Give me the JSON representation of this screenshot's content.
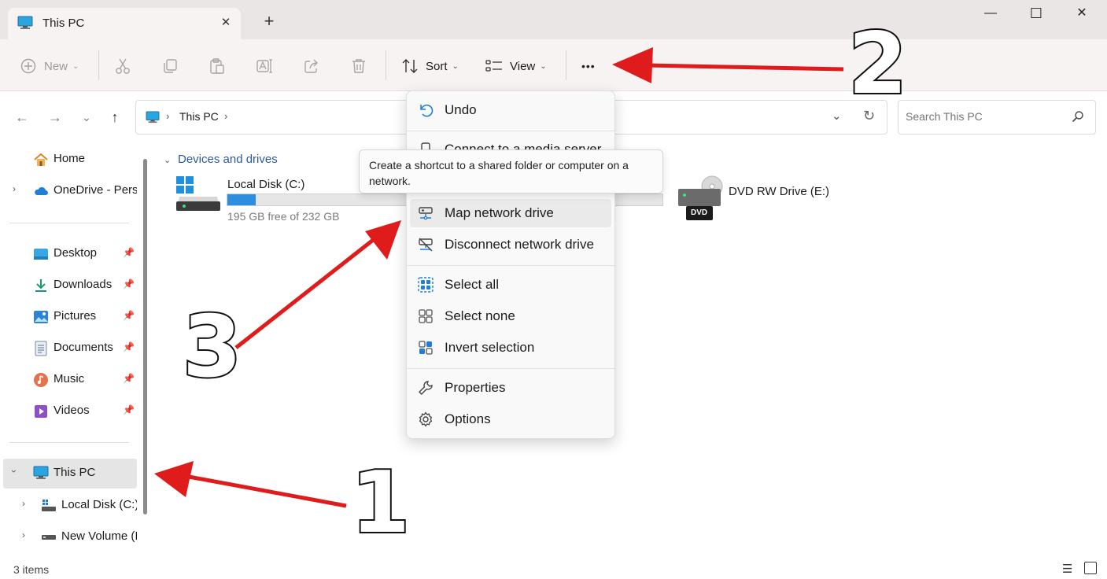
{
  "window": {
    "tab_title": "This PC",
    "new_tab_symbol": "+",
    "minimize_symbol": "—",
    "maximize_symbol": "☐",
    "close_symbol": "✕"
  },
  "toolbar": {
    "new_label": "New",
    "sort_label": "Sort",
    "view_label": "View",
    "more_label": "•••"
  },
  "address": {
    "path_item": "This PC",
    "search_placeholder": "Search This PC"
  },
  "sidebar": {
    "home": "Home",
    "onedrive": "OneDrive - Perso",
    "quick": [
      {
        "label": "Desktop",
        "icon": "desktop-folder-icon"
      },
      {
        "label": "Downloads",
        "icon": "downloads-icon"
      },
      {
        "label": "Pictures",
        "icon": "pictures-icon"
      },
      {
        "label": "Documents",
        "icon": "documents-icon"
      },
      {
        "label": "Music",
        "icon": "music-icon"
      },
      {
        "label": "Videos",
        "icon": "videos-icon"
      }
    ],
    "this_pc": "This PC",
    "local_disk": "Local Disk (C:)",
    "new_volume": "New Volume (I"
  },
  "content": {
    "group_header": "Devices and drives",
    "drives": [
      {
        "name": "Local Disk (C:)",
        "free_text": "195 GB free of 232 GB",
        "used_fraction": 0.16
      },
      {
        "name": "DVD RW Drive (E:)",
        "badge": "DVD"
      }
    ]
  },
  "menu": {
    "items": [
      {
        "label": "Undo",
        "icon": "undo-icon"
      },
      {
        "label": "Connect to a media server",
        "icon": "media-server-icon"
      },
      {
        "label": "Map network drive",
        "icon": "map-network-drive-icon"
      },
      {
        "label": "Disconnect network drive",
        "icon": "disconnect-network-drive-icon"
      },
      {
        "label": "Select all",
        "icon": "select-all-icon"
      },
      {
        "label": "Select none",
        "icon": "select-none-icon"
      },
      {
        "label": "Invert selection",
        "icon": "invert-selection-icon"
      },
      {
        "label": "Properties",
        "icon": "properties-icon"
      },
      {
        "label": "Options",
        "icon": "options-icon"
      }
    ],
    "tooltip": "Create a shortcut to a shared folder or computer on a network."
  },
  "status": {
    "item_count": "3 items"
  },
  "annotations": {
    "one": "1",
    "two": "2",
    "three": "3"
  },
  "colors": {
    "accent": "#2c7fd4",
    "arrow": "#e01b1b",
    "menu_highlight": "#eaeaea"
  }
}
